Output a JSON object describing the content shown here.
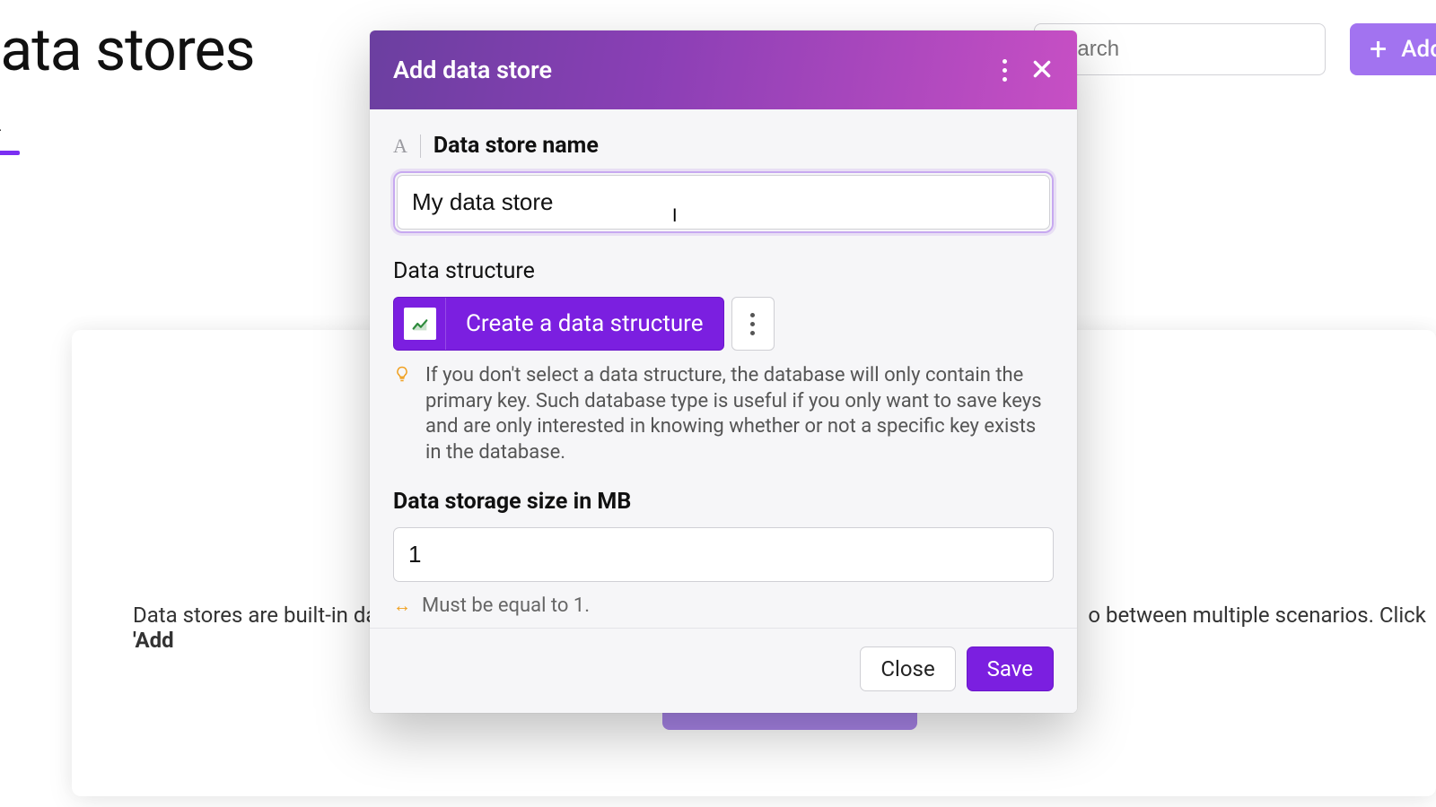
{
  "background": {
    "page_title": "Data stores",
    "tab_label_fragment": "L",
    "search_placeholder": "Search",
    "add_button_label": "Add",
    "description_left": "Data stores are built-in da",
    "description_right": "o between multiple scenarios. Click ",
    "description_bold": "'Add"
  },
  "modal": {
    "title": "Add data store",
    "name_field": {
      "label": "Data store name",
      "value": "My data store"
    },
    "structure": {
      "label": "Data structure",
      "button_label": "Create a data structure",
      "hint": "If you don't select a data structure, the database will only contain the primary key. Such database type is useful if you only want to save keys and are only interested in knowing whether or not a specific key exists in the database."
    },
    "size": {
      "label": "Data storage size in MB",
      "value": "1",
      "constraint": "Must be equal to 1."
    },
    "footer": {
      "close": "Close",
      "save": "Save"
    }
  }
}
